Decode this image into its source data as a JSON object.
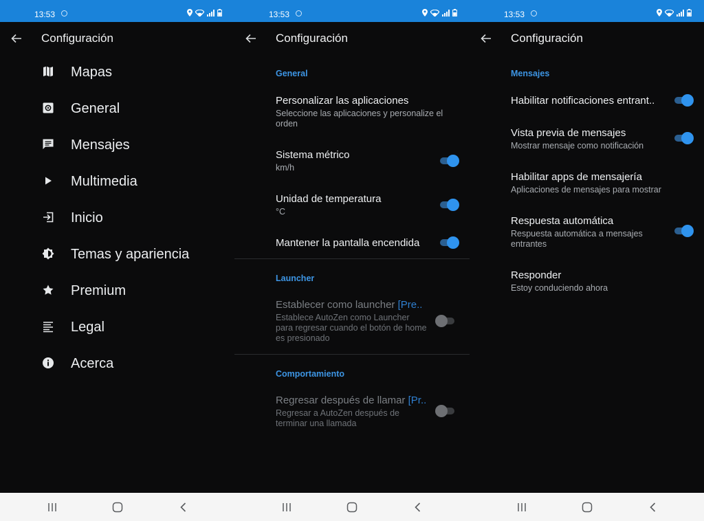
{
  "status": {
    "time": "13:53"
  },
  "colors": {
    "statusbar": "#1a83da",
    "accent": "#2f93ee",
    "section": "#3d95e4",
    "background": "#0b0b0c"
  },
  "screens": [
    {
      "title": "Configuración",
      "menu": [
        {
          "label": "Mapas",
          "icon": "map-icon"
        },
        {
          "label": "General",
          "icon": "settings-box-icon"
        },
        {
          "label": "Mensajes",
          "icon": "message-icon"
        },
        {
          "label": "Multimedia",
          "icon": "play-icon"
        },
        {
          "label": "Inicio",
          "icon": "login-icon"
        },
        {
          "label": "Temas y apariencia",
          "icon": "brightness-icon"
        },
        {
          "label": "Premium",
          "icon": "star-icon"
        },
        {
          "label": "Legal",
          "icon": "text-lines-icon"
        },
        {
          "label": "Acerca",
          "icon": "info-icon"
        }
      ]
    },
    {
      "title": "Configuración",
      "sections": [
        {
          "header": "General",
          "items": [
            {
              "title": "Personalizar las aplicaciones",
              "summary": "Seleccione las aplicaciones y personalize el orden"
            },
            {
              "title": "Sistema métrico",
              "summary": "km/h",
              "toggle": true
            },
            {
              "title": "Unidad de temperatura",
              "summary": "°C",
              "toggle": true
            },
            {
              "title": "Mantener la pantalla encendida",
              "toggle": true
            }
          ]
        },
        {
          "header": "Launcher",
          "items": [
            {
              "title": "Establecer como launcher",
              "badge": "[Pre..",
              "summary": "Establece AutoZen como Launcher para regresar cuando el botón de home es presionado",
              "toggle": false,
              "disabled": true
            }
          ]
        },
        {
          "header": "Comportamiento",
          "items": [
            {
              "title": "Regresar después de llamar",
              "badge": "[Pr..",
              "summary": "Regresar a AutoZen después de terminar una llamada",
              "toggle": false,
              "disabled": true
            }
          ]
        }
      ]
    },
    {
      "title": "Configuración",
      "section": "Mensajes",
      "items": [
        {
          "title": "Habilitar notificaciones entrant..",
          "toggle": true
        },
        {
          "title": "Vista previa de mensajes",
          "summary": "Mostrar mensaje como notificación",
          "toggle": true
        },
        {
          "title": "Habilitar apps de mensajería",
          "summary": "Aplicaciones de mensajes para mostrar"
        },
        {
          "title": "Respuesta automática",
          "summary": "Respuesta automática a mensajes entrantes",
          "toggle": true
        },
        {
          "title": "Responder",
          "summary": "Estoy conduciendo ahora"
        }
      ]
    }
  ]
}
